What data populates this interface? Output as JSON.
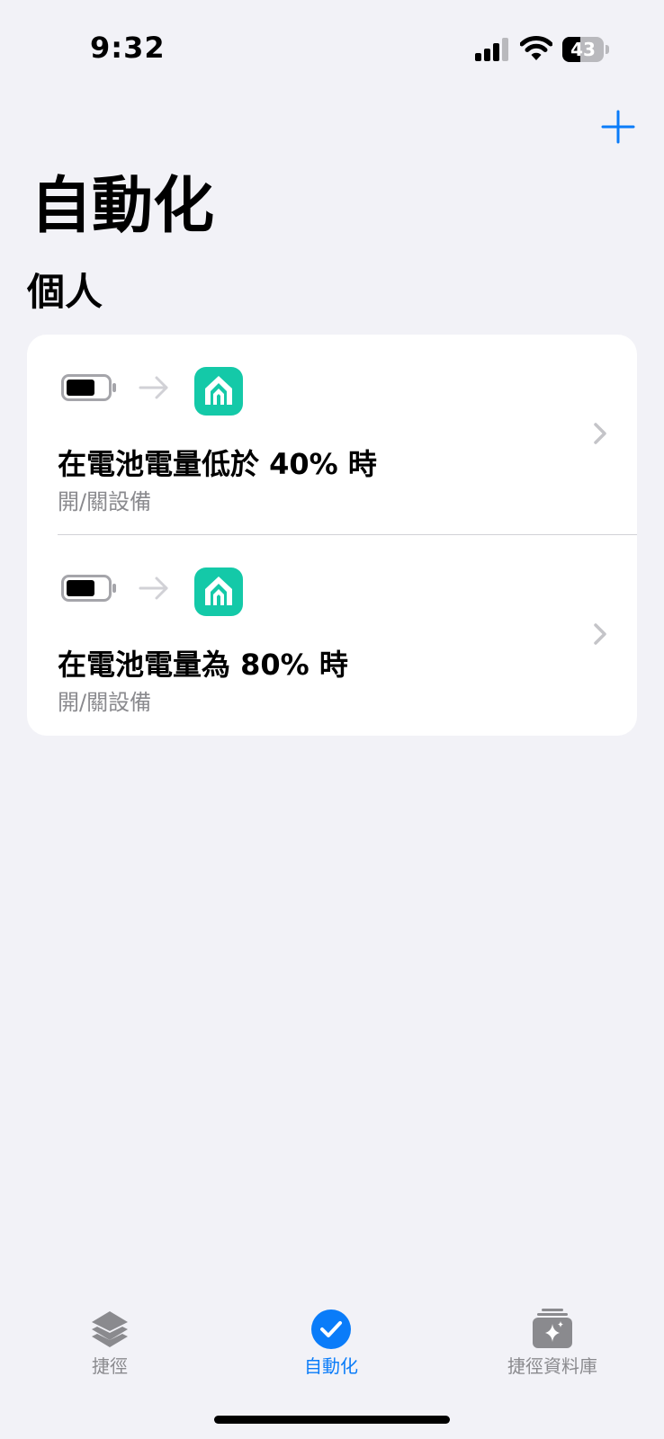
{
  "status_bar": {
    "time": "9:32",
    "battery_percent": "43",
    "battery_level": 0.43
  },
  "header": {
    "title": "自動化",
    "add_icon": "plus-icon"
  },
  "section": {
    "title": "個人"
  },
  "automations": [
    {
      "trigger_icon": "battery-icon",
      "app_icon": "home-app-icon",
      "title": "在電池電量低於 40% 時",
      "subtitle": "開/關設備"
    },
    {
      "trigger_icon": "battery-icon",
      "app_icon": "home-app-icon",
      "title": "在電池電量為 80% 時",
      "subtitle": "開/關設備"
    }
  ],
  "tab_bar": {
    "tabs": [
      {
        "label": "捷徑",
        "icon": "layers-icon",
        "active": false
      },
      {
        "label": "自動化",
        "icon": "check-circle-icon",
        "active": true
      },
      {
        "label": "捷徑資料庫",
        "icon": "gallery-icon",
        "active": false
      }
    ]
  },
  "colors": {
    "accent": "#0a7cf9",
    "app_icon_bg": "#14c9a8",
    "background": "#f2f2f7"
  }
}
